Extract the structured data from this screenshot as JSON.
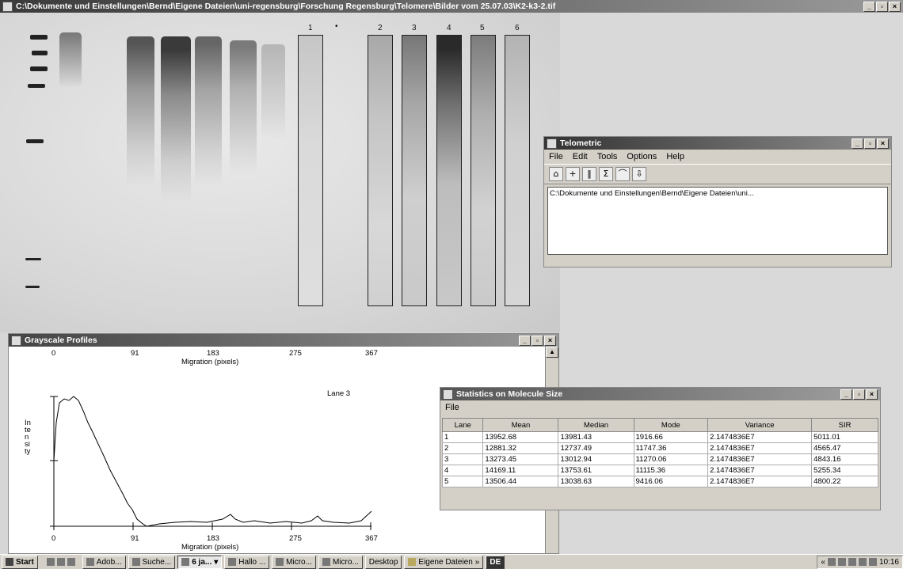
{
  "main_window": {
    "title": "C:\\Dokumente und Einstellungen\\Bernd\\Eigene Dateien\\uni-regensburg\\Forschung Regensburg\\Telomere\\Bilder vom 25.07.03\\K2-k3-2.tif",
    "lane_numbers": [
      "1",
      "2",
      "3",
      "4",
      "5",
      "6"
    ]
  },
  "telometric": {
    "title": "Telometric",
    "menu": [
      "File",
      "Edit",
      "Tools",
      "Options",
      "Help"
    ],
    "toolbar_icons": [
      "open-icon",
      "crosshair-icon",
      "lanes-icon",
      "sigma-icon",
      "profile-icon",
      "export-icon"
    ],
    "path_text": "C:\\Dokumente und Einstellungen\\Bernd\\Eigene Dateien\\uni..."
  },
  "grayscale": {
    "title": "Grayscale Profiles",
    "top_ticks": [
      "0",
      "91",
      "183",
      "275",
      "367"
    ],
    "bottom_ticks": [
      "0",
      "91",
      "183",
      "275",
      "367"
    ],
    "xlabel_top": "Migration (pixels)",
    "xlabel_bottom": "Migration (pixels)",
    "ylabel": "Intensity",
    "lane_label": "Lane 3"
  },
  "stats": {
    "title": "Statistics on Molecule Size",
    "menu": [
      "File"
    ],
    "columns": [
      "Lane",
      "Mean",
      "Median",
      "Mode",
      "Variance",
      "SIR"
    ],
    "rows": [
      [
        "1",
        "13952.68",
        "13981.43",
        "1916.66",
        "2.1474836E7",
        "5011.01"
      ],
      [
        "2",
        "12881.32",
        "12737.49",
        "11747.36",
        "2.1474836E7",
        "4565.47"
      ],
      [
        "3",
        "13273.45",
        "13012.94",
        "11270.06",
        "2.1474836E7",
        "4843.16"
      ],
      [
        "4",
        "14169.11",
        "13753.61",
        "11115.36",
        "2.1474836E7",
        "5255.34"
      ],
      [
        "5",
        "13506.44",
        "13038.63",
        "9416.06",
        "2.1474836E7",
        "4800.22"
      ]
    ]
  },
  "taskbar": {
    "start": "Start",
    "tasks": [
      "Adob...",
      "Suche...",
      "6 ja...",
      "Hallo ...",
      "Micro...",
      "Micro..."
    ],
    "desktop": "Desktop",
    "folder": "Eigene Dateien",
    "lang": "DE",
    "clock": "10:16"
  }
}
